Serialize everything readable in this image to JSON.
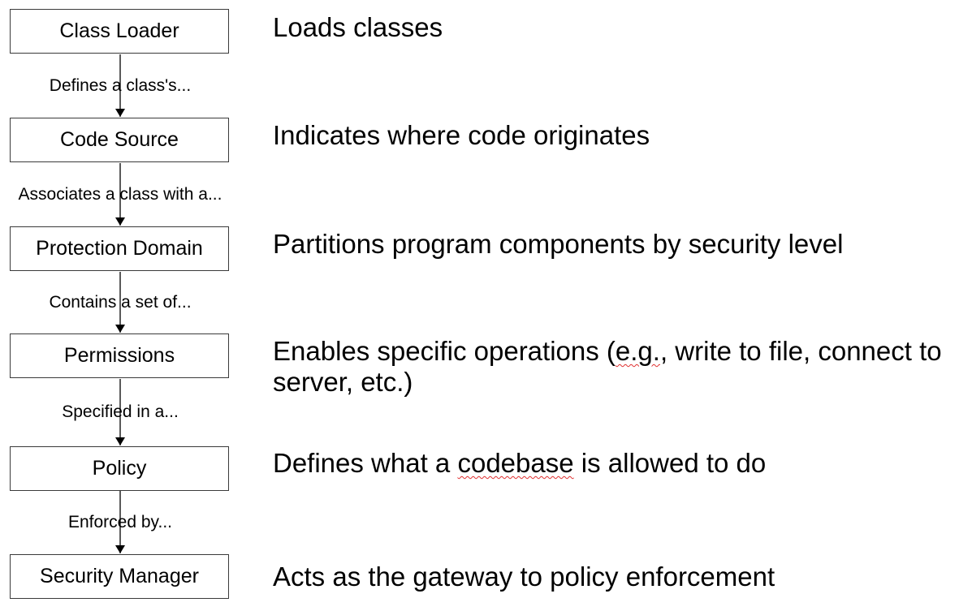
{
  "boxes": [
    {
      "label": "Class Loader"
    },
    {
      "label": "Code Source"
    },
    {
      "label": "Protection Domain"
    },
    {
      "label": "Permissions"
    },
    {
      "label": "Policy"
    },
    {
      "label": "Security Manager"
    }
  ],
  "connectors": [
    {
      "label": "Defines a class's..."
    },
    {
      "label": "Associates a class with a..."
    },
    {
      "label": "Contains a set of..."
    },
    {
      "label": "Specified in a..."
    },
    {
      "label": "Enforced by..."
    }
  ],
  "descriptions": [
    {
      "text": "Loads classes"
    },
    {
      "text": "Indicates where code originates"
    },
    {
      "text": "Partitions program components by security level"
    },
    {
      "line1_pre": "Enables specific operations (",
      "line1_spell": "e.g.",
      "line1_post": ", write to file, connect to",
      "line2": "server, etc.)"
    },
    {
      "pre": "Defines what a ",
      "spell": "codebase",
      "post": " is allowed to do"
    },
    {
      "text": "Acts as the gateway to policy enforcement"
    }
  ]
}
